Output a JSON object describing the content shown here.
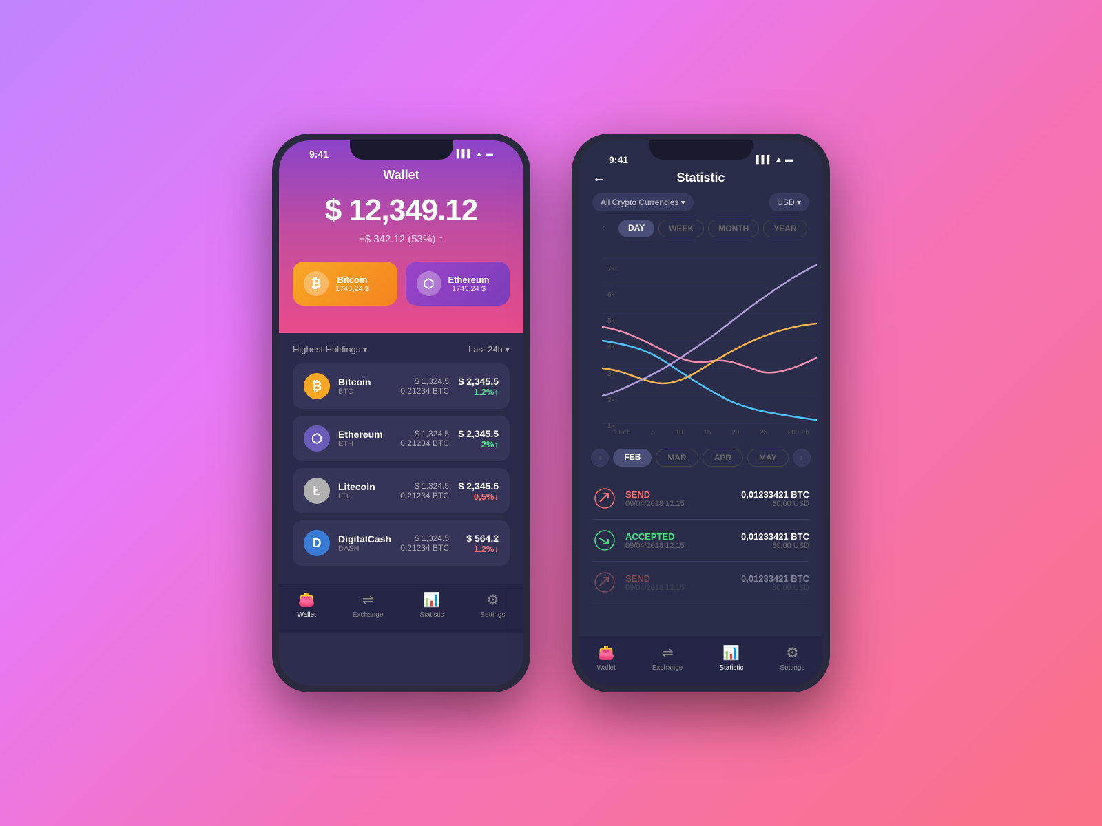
{
  "background": "linear-gradient(135deg, #c084fc 0%, #e879f9 30%, #f472b6 60%, #fb7185 100%)",
  "phone1": {
    "status": {
      "time": "9:41",
      "icons": "▌▌▌ ▲ 🔋"
    },
    "title": "Wallet",
    "balance": "$ 12,349.12",
    "change": "+$ 342.12 (53%) ↑",
    "cards": [
      {
        "name": "Bitcoin",
        "value": "1745,24 $",
        "icon": "₿",
        "type": "btc"
      },
      {
        "name": "Ethereum",
        "value": "1745,24 $",
        "icon": "⬡",
        "type": "eth"
      }
    ],
    "section_left": "Highest Holdings ▾",
    "section_right": "Last 24h ▾",
    "crypto_list": [
      {
        "name": "Bitcoin",
        "symbol": "BTC",
        "icon": "₿",
        "type": "btc",
        "price": "$ 1,324.5",
        "btc": "0,21234 BTC",
        "value": "$ 2,345.5",
        "change": "1.2%↑",
        "up": true
      },
      {
        "name": "Ethereum",
        "symbol": "ETH",
        "icon": "⬡",
        "type": "eth",
        "price": "$ 1,324.5",
        "btc": "0,21234 BTC",
        "value": "$ 2,345.5",
        "change": "2%↑",
        "up": true
      },
      {
        "name": "Litecoin",
        "symbol": "LTC",
        "icon": "Ł",
        "type": "ltc",
        "price": "$ 1,324.5",
        "btc": "0,21234 BTC",
        "value": "$ 2,345.5",
        "change": "0,5%↓",
        "up": false
      },
      {
        "name": "DigitalCash",
        "symbol": "DASH",
        "icon": "D",
        "type": "dash",
        "price": "$ 1,324.5",
        "btc": "0,21234 BTC",
        "value": "$ 564.2",
        "change": "1.2%↓",
        "up": false
      }
    ],
    "nav": [
      {
        "label": "Wallet",
        "active": true,
        "icon": "👛"
      },
      {
        "label": "Exchange",
        "active": false,
        "icon": "⇌"
      },
      {
        "label": "Statistic",
        "active": false,
        "icon": "📊"
      },
      {
        "label": "Settings",
        "active": false,
        "icon": "⚙"
      }
    ]
  },
  "phone2": {
    "status": {
      "time": "9:41"
    },
    "title": "Statistic",
    "back": "←",
    "filter_currency": "All Crypto Currencies ▾",
    "filter_unit": "USD ▾",
    "time_tabs": [
      "DAY",
      "WEEK",
      "MONTH",
      "YEAR"
    ],
    "active_time_tab": "DAY",
    "chart": {
      "y_labels": [
        "7k",
        "6k",
        "5k",
        "4k",
        "3k",
        "2k",
        "1k"
      ],
      "x_labels": [
        "1 Feb",
        "5",
        "10",
        "15",
        "20",
        "25",
        "30 Feb"
      ]
    },
    "month_tabs": [
      "FEB",
      "MAR",
      "APR",
      "MAY"
    ],
    "active_month_tab": "FEB",
    "transactions": [
      {
        "type": "SEND",
        "date": "09/04/2018 12:15",
        "btc": "0,01233421 BTC",
        "usd": "80,00 USD",
        "kind": "send",
        "dim": false
      },
      {
        "type": "ACCEPTED",
        "date": "09/04/2018 12:15",
        "btc": "0,01233421 BTC",
        "usd": "80,00 USD",
        "kind": "accepted",
        "dim": false
      },
      {
        "type": "SEND",
        "date": "09/04/2018 12:15",
        "btc": "0,01233421 BTC",
        "usd": "80,00 USD",
        "kind": "send",
        "dim": true
      }
    ],
    "nav": [
      {
        "label": "Wallet",
        "active": false,
        "icon": "👛"
      },
      {
        "label": "Exchange",
        "active": false,
        "icon": "⇌"
      },
      {
        "label": "Statistic",
        "active": true,
        "icon": "📊"
      },
      {
        "label": "Settings",
        "active": false,
        "icon": "⚙"
      }
    ]
  }
}
